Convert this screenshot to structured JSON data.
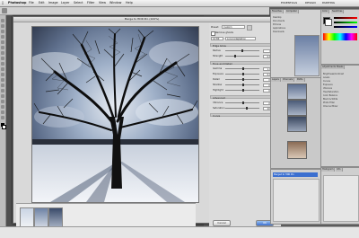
{
  "menubar": {
    "app": "Photoshop",
    "items": [
      "File",
      "Edit",
      "Image",
      "Layer",
      "Select",
      "Filter",
      "View",
      "Window",
      "Help"
    ],
    "workspace": [
      "ESSENTIALS",
      "DESIGN",
      "PAINTING"
    ]
  },
  "dialog": {
    "title": "Merge to HDR Pro (100%)",
    "preset_label": "Preset:",
    "preset_value": "Custom",
    "remove_ghosts": "Remove ghosts",
    "mode_value": "16 Bit",
    "method_value": "Local Adaptation",
    "edge_glow": "Edge Glow",
    "tone_detail": "Tone and Detail",
    "advanced": "Advanced",
    "curve": "Curve",
    "sliders": [
      {
        "label": "Radius",
        "value": "72"
      },
      {
        "label": "Strength",
        "value": "0.65"
      },
      {
        "label": "Gamma",
        "value": "1.00"
      },
      {
        "label": "Exposure",
        "value": "0.00"
      },
      {
        "label": "Detail",
        "value": "0%"
      },
      {
        "label": "Shadow",
        "value": "0%"
      },
      {
        "label": "Highlight",
        "value": "0%"
      },
      {
        "label": "Vibrance",
        "value": "0%"
      },
      {
        "label": "Saturation",
        "value": "20%"
      }
    ],
    "cancel": "Cancel",
    "ok": "OK",
    "complete_toning": "Complete Toning in Adobe Camera Raw",
    "strip_label": "3 Exposures"
  },
  "panels": {
    "nav_tabs": [
      "Favorites",
      "Computer"
    ],
    "nav_items": [
      "Desktop",
      "Documents",
      "Pictures",
      "Applications",
      "Downloads"
    ],
    "layers_tabs": [
      "Layers",
      "Channels",
      "Paths"
    ],
    "layer_name": "Merged to HDR Pro",
    "adj_tabs": [
      "Adjustments",
      "Masks"
    ],
    "adj_items": [
      "Brightness/Contrast",
      "Levels",
      "Curves",
      "Exposure",
      "Vibrance",
      "Hue/Saturation",
      "Color Balance",
      "Black & White",
      "Photo Filter",
      "Channel Mixer"
    ],
    "color_tabs": [
      "Color",
      "Swatches"
    ],
    "hist_tabs": [
      "Histogram",
      "Info"
    ]
  },
  "colors": {
    "accent": "#3b6fd0",
    "sky": "#6f87b4"
  }
}
